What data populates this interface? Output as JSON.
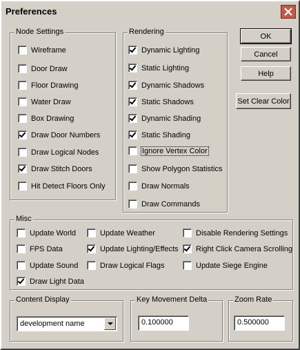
{
  "window": {
    "title": "Preferences"
  },
  "node_settings": {
    "label": "Node Settings",
    "items": [
      {
        "label": "Wireframe",
        "checked": false
      },
      {
        "label": "Door Draw",
        "checked": false
      },
      {
        "label": "Floor Drawing",
        "checked": false
      },
      {
        "label": "Water Draw",
        "checked": false
      },
      {
        "label": "Box Drawing",
        "checked": false
      },
      {
        "label": "Draw Door Numbers",
        "checked": true
      },
      {
        "label": "Draw Logical Nodes",
        "checked": false
      },
      {
        "label": "Draw Stitch Doors",
        "checked": true
      },
      {
        "label": "Hit Detect Floors Only",
        "checked": false
      }
    ]
  },
  "rendering": {
    "label": "Rendering",
    "items": [
      {
        "label": "Dynamic Lighting",
        "checked": true
      },
      {
        "label": "Static Lighting",
        "checked": true
      },
      {
        "label": "Dynamic Shadows",
        "checked": true
      },
      {
        "label": "Static Shadows",
        "checked": true
      },
      {
        "label": "Dynamic Shading",
        "checked": true
      },
      {
        "label": "Static Shading",
        "checked": true
      },
      {
        "label": "Ignore Vertex Color",
        "checked": false
      },
      {
        "label": "Show Polygon Statistics",
        "checked": false
      },
      {
        "label": "Draw Normals",
        "checked": false
      },
      {
        "label": "Draw Commands",
        "checked": false
      }
    ]
  },
  "buttons": {
    "ok": "OK",
    "cancel": "Cancel",
    "help": "Help",
    "clear_color": "Set Clear Color"
  },
  "misc": {
    "label": "Misc",
    "items": [
      {
        "label": "Update World",
        "checked": false
      },
      {
        "label": "FPS Data",
        "checked": false
      },
      {
        "label": "Update Sound",
        "checked": false
      },
      {
        "label": "Draw Light Data",
        "checked": true
      },
      {
        "label": "Update Weather",
        "checked": false
      },
      {
        "label": "Update Lighting/Effects",
        "checked": true
      },
      {
        "label": "Draw Logical Flags",
        "checked": false
      },
      {
        "label": "Disable Rendering Settings",
        "checked": false
      },
      {
        "label": "Right Click Camera Scrolling",
        "checked": true
      },
      {
        "label": "Update Siege Engine",
        "checked": false
      }
    ]
  },
  "content_display": {
    "label": "Content Display",
    "value": "development name"
  },
  "key_movement": {
    "label": "Key Movement Delta",
    "value": "0.100000"
  },
  "zoom_rate": {
    "label": "Zoom Rate",
    "value": "0.500000"
  },
  "icons": {
    "close": "close-icon",
    "dropdown": "chevron-down-icon",
    "check": "checkmark-icon"
  }
}
